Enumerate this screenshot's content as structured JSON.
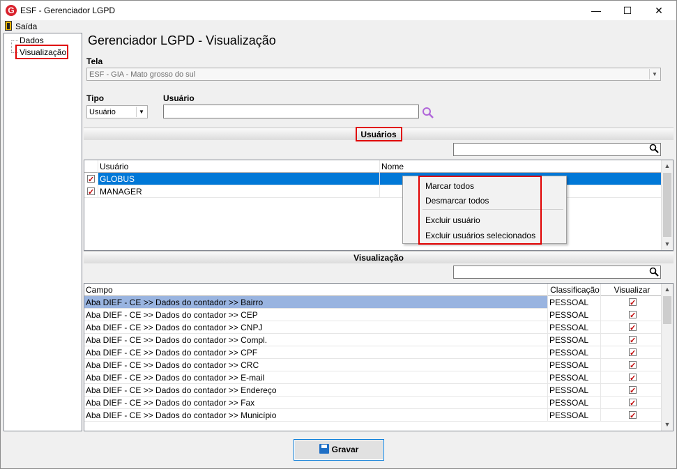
{
  "window": {
    "title": "ESF - Gerenciador LGPD",
    "app_icon_letter": "G",
    "minimize": "—",
    "maximize": "☐",
    "close": "✕"
  },
  "menubar": {
    "exit_label": "Saída"
  },
  "tree": {
    "items": [
      {
        "label": "Dados"
      },
      {
        "label": "Visualização"
      }
    ]
  },
  "heading": "Gerenciador LGPD - Visualização",
  "tela": {
    "label": "Tela",
    "value": "ESF - GIA - Mato grosso do sul"
  },
  "tipo": {
    "label": "Tipo",
    "value": "Usuário"
  },
  "usuario": {
    "label": "Usuário",
    "value": ""
  },
  "usuarios_section": {
    "title": "Usuários",
    "search_value": "",
    "columns": [
      "Usuário",
      "Nome"
    ],
    "rows": [
      {
        "usuario": "GLOBUS",
        "nome": "",
        "checked": true,
        "selected": true
      },
      {
        "usuario": "MANAGER",
        "nome": "",
        "checked": true,
        "selected": false
      }
    ]
  },
  "context_menu": {
    "items": [
      "Marcar todos",
      "Desmarcar todos",
      "Excluir usuário",
      "Excluir usuários selecionados"
    ]
  },
  "visualizacao_section": {
    "title": "Visualização",
    "search_value": "",
    "columns": [
      "Campo",
      "Classificação",
      "Visualizar"
    ],
    "rows": [
      {
        "campo": "Aba DIEF - CE >> Dados do contador >> Bairro",
        "classificacao": "PESSOAL",
        "visualizar": true,
        "selected": true
      },
      {
        "campo": "Aba DIEF - CE >> Dados do contador >> CEP",
        "classificacao": "PESSOAL",
        "visualizar": true
      },
      {
        "campo": "Aba DIEF - CE >> Dados do contador >> CNPJ",
        "classificacao": "PESSOAL",
        "visualizar": true
      },
      {
        "campo": "Aba DIEF - CE >> Dados do contador >> Compl.",
        "classificacao": "PESSOAL",
        "visualizar": true
      },
      {
        "campo": "Aba DIEF - CE >> Dados do contador >> CPF",
        "classificacao": "PESSOAL",
        "visualizar": true
      },
      {
        "campo": "Aba DIEF - CE >> Dados do contador >> CRC",
        "classificacao": "PESSOAL",
        "visualizar": true
      },
      {
        "campo": "Aba DIEF - CE >> Dados do contador >> E-mail",
        "classificacao": "PESSOAL",
        "visualizar": true
      },
      {
        "campo": "Aba DIEF - CE >> Dados do contador >> Endereço",
        "classificacao": "PESSOAL",
        "visualizar": true
      },
      {
        "campo": "Aba DIEF - CE >> Dados do contador >> Fax",
        "classificacao": "PESSOAL",
        "visualizar": true
      },
      {
        "campo": "Aba DIEF - CE >> Dados do contador >> Município",
        "classificacao": "PESSOAL",
        "visualizar": true
      }
    ]
  },
  "gravar_label": "Gravar",
  "colors": {
    "selection": "#0078d7",
    "row_highlight": "#99b4e0",
    "annotation": "#e00000"
  }
}
